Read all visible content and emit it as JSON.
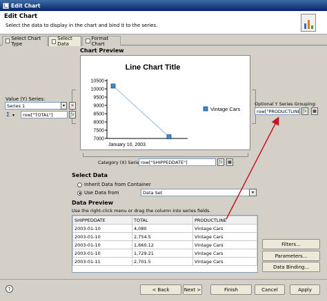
{
  "window": {
    "title": "Edit Chart"
  },
  "header": {
    "title": "Edit Chart",
    "subtitle": "Select the data to display in the chart and bind it to the series."
  },
  "tabs": [
    {
      "label": "Select Chart Type",
      "active": false
    },
    {
      "label": "Select Data",
      "active": true
    },
    {
      "label": "Format Chart",
      "active": false
    }
  ],
  "preview": {
    "label": "Chart Preview",
    "chart_data": {
      "type": "line",
      "title": "Line Chart Title",
      "x": [
        "January 10, 2003",
        ""
      ],
      "series": [
        {
          "name": "Vintage Cars",
          "values": [
            10170,
            7100
          ]
        }
      ],
      "yticks": [
        10500,
        10000,
        9500,
        9000,
        8500,
        8000,
        7500,
        7000
      ],
      "ylim": [
        7000,
        10500
      ],
      "xlabel": "",
      "ylabel": "",
      "grid": false,
      "legend": "right",
      "colors": {
        "line": "#9ec3e8",
        "marker": "#3d8dcc",
        "marker_border": "#1e4a78"
      }
    }
  },
  "value_series": {
    "label": "Value (Y) Series:",
    "selected": "Series 1",
    "sigma": "Σ",
    "expression": "row[\"TOTAL\"]"
  },
  "grouping": {
    "label": "Optional Y Series Grouping:",
    "expression": "row[\"PRODUCTLINE\"]"
  },
  "category": {
    "label": "Category (X) Series:",
    "expression": "row[\"SHIPPEDDATE\"]"
  },
  "select_data": {
    "label": "Select Data",
    "option1": "Inherit Data from Container",
    "option2": "Use Data from",
    "dataset": "Data Set"
  },
  "data_preview": {
    "label": "Data Preview",
    "hint": "Use the right-click menu or drag the column into series fields.",
    "columns": [
      "SHIPPEDDATE",
      "TOTAL",
      "PRODUCTLINE"
    ],
    "rows": [
      [
        "2003-01-10",
        "4,080",
        "Vintage Cars"
      ],
      [
        "2003-01-10",
        "2,754.5",
        "Vintage Cars"
      ],
      [
        "2003-01-10",
        "1,660.12",
        "Vintage Cars"
      ],
      [
        "2003-01-10",
        "1,729.21",
        "Vintage Cars"
      ],
      [
        "2003-01-11",
        "2,701.5",
        "Vintage Cars"
      ]
    ]
  },
  "side_buttons": {
    "filters": "Filters...",
    "parameters": "Parameters...",
    "binding": "Data Binding..."
  },
  "footer": {
    "back": "< Back",
    "next": "Next >",
    "finish": "Finish",
    "cancel": "Cancel",
    "apply": "Apply",
    "help": "?"
  },
  "colors": {
    "accent": "#0a246a",
    "annotation_arrow": "#c0181e"
  }
}
